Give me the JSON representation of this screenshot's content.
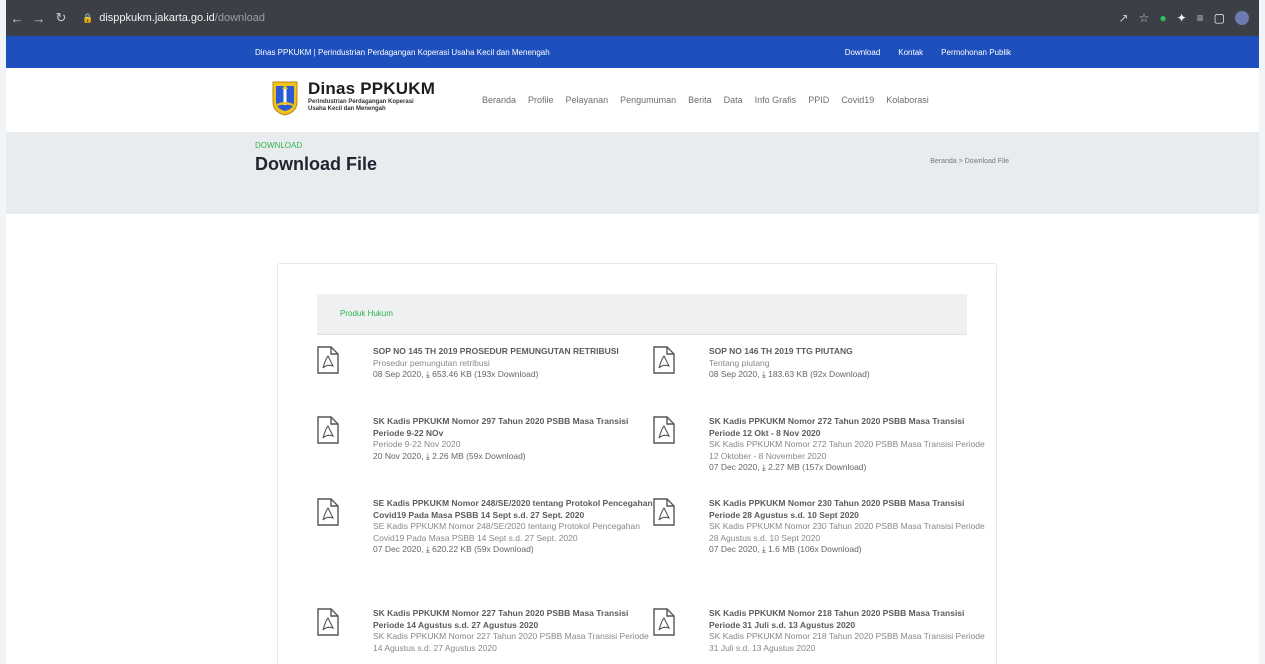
{
  "browser": {
    "url_host": "disppkukm.jakarta.go.id",
    "url_path": "/download"
  },
  "topbar": {
    "tagline": "Dinas PPKUKM | Perindustrian Perdagangan Koperasi Usaha Kecil dan Menengah",
    "links": [
      "Download",
      "Kontak",
      "Permohonan Publik"
    ]
  },
  "brand": {
    "title": "Dinas PPKUKM",
    "sub1": "Perindustrian Perdagangan Koperasi",
    "sub2": "Usaha Kecil dan Menengah"
  },
  "nav": [
    "Beranda",
    "Profile",
    "Pelayanan",
    "Pengumuman",
    "Berita",
    "Data",
    "Info Grafis",
    "PPID",
    "Covid19",
    "Kolaborasi"
  ],
  "page": {
    "kicker": "DOWNLOAD",
    "title": "Download File",
    "breadcrumb": "Beranda > Download File"
  },
  "tab": {
    "label": "Produk Hukum"
  },
  "files": [
    {
      "title": "SOP NO 145 TH 2019 PROSEDUR PEMUNGUTAN RETRIBUSI",
      "desc": "Prosedur pemungutan retribusi",
      "date": "08 Sep 2020,",
      "size": "653.46 KB (193x Download)"
    },
    {
      "title": "SOP NO 146 TH 2019 TTG PIUTANG",
      "desc": "Tentang piutang",
      "date": "08 Sep 2020,",
      "size": "183.63 KB (92x Download)"
    },
    {
      "title": "SK Kadis PPKUKM Nomor 297 Tahun 2020 PSBB Masa Transisi Periode 9-22 NOv",
      "desc": "Periode 9-22 Nov 2020",
      "date": "20 Nov 2020,",
      "size": "2.26 MB (59x Download)"
    },
    {
      "title": "SK Kadis PPKUKM Nomor 272 Tahun 2020 PSBB Masa Transisi Periode 12 Okt - 8 Nov 2020",
      "desc": "SK Kadis PPKUKM Nomor 272 Tahun 2020 PSBB Masa Transisi Periode 12 Oktober - 8 November 2020",
      "date": "07 Dec 2020,",
      "size": "2.27 MB (157x Download)"
    },
    {
      "title": "SE Kadis PPKUKM Nomor 248/SE/2020 tentang Protokol Pencegahan Covid19 Pada Masa PSBB 14 Sept s.d. 27 Sept. 2020",
      "desc": "SE Kadis PPKUKM Nomor 248/SE/2020 tentang Protokol Pencegahan Covid19 Pada Masa PSBB 14 Sept s.d. 27 Sept. 2020",
      "date": "07 Dec 2020,",
      "size": "620.22 KB (59x Download)"
    },
    {
      "title": "SK Kadis PPKUKM Nomor 230 Tahun 2020 PSBB Masa Transisi Periode 28 Agustus s.d. 10 Sept 2020",
      "desc": "SK Kadis PPKUKM Nomor 230 Tahun 2020 PSBB Masa Transisi Periode 28 Agustus s.d. 10 Sept 2020",
      "date": "07 Dec 2020,",
      "size": "1.6 MB (106x Download)"
    },
    {
      "title": "SK Kadis PPKUKM Nomor 227 Tahun 2020 PSBB Masa Transisi Periode 14 Agustus s.d. 27 Agustus 2020",
      "desc": "SK Kadis PPKUKM Nomor 227 Tahun 2020 PSBB Masa Transisi Periode 14 Agustus s.d. 27 Agustus 2020",
      "date": "",
      "size": ""
    },
    {
      "title": "SK Kadis PPKUKM Nomor 218 Tahun 2020 PSBB Masa Transisi Periode 31 Juli s.d. 13 Agustus 2020",
      "desc": "SK Kadis PPKUKM Nomor 218 Tahun 2020 PSBB Masa Transisi Periode 31 Juli s.d. 13 Agustus 2020",
      "date": "",
      "size": ""
    }
  ]
}
